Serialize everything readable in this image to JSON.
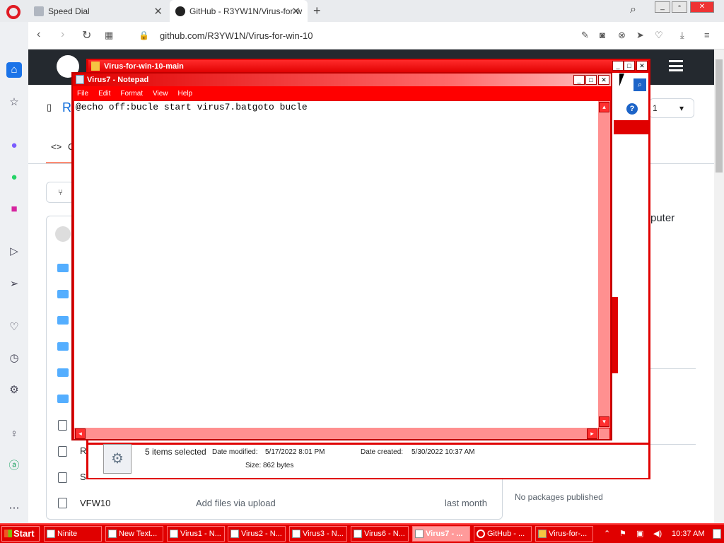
{
  "browser": {
    "tabs": [
      {
        "label": "Speed Dial",
        "icon": "speed-dial-icon"
      },
      {
        "label": "GitHub - R3YW1N/Virus-for-w",
        "icon": "github-icon"
      }
    ],
    "url": "github.com/R3YW1N/Virus-for-win-10"
  },
  "github": {
    "partial_heading": "R",
    "partial_code_tab": "C",
    "about_partial": "puter",
    "file_rows": [
      {
        "name": "R",
        "message": "",
        "time": ""
      },
      {
        "name": "S",
        "message": "",
        "time": ""
      },
      {
        "name": "VFW10",
        "message": "Add files via upload",
        "time": "last month"
      }
    ],
    "branch_count": "1",
    "packages_text": "No packages published"
  },
  "explorer": {
    "title": "Virus-for-win-10-main",
    "status": {
      "selected": "5 items selected",
      "modified_label": "Date modified:",
      "modified_value": "5/17/2022 8:01 PM",
      "created_label": "Date created:",
      "created_value": "5/30/2022 10:37 AM",
      "size_label": "Size:",
      "size_value": "862 bytes"
    }
  },
  "notepad": {
    "title": "Virus7 - Notepad",
    "menu": [
      "File",
      "Edit",
      "Format",
      "View",
      "Help"
    ],
    "content": "@echo off:bucle start virus7.batgoto bucle"
  },
  "taskbar": {
    "start_label": "Start",
    "items": [
      {
        "label": "Ninite",
        "active": false
      },
      {
        "label": "New Text...",
        "active": false
      },
      {
        "label": "Virus1 - N...",
        "active": false
      },
      {
        "label": "Virus2 - N...",
        "active": false
      },
      {
        "label": "Virus3 - N...",
        "active": false
      },
      {
        "label": "Virus6 - N...",
        "active": false
      },
      {
        "label": "Virus7 - ...",
        "active": true
      },
      {
        "label": "GitHub - ...",
        "active": false
      },
      {
        "label": "Virus-for-...",
        "active": false
      }
    ],
    "clock": "10:37 AM"
  },
  "colors": {
    "theme_red": "#e00000",
    "github_dark": "#24292f",
    "opera_red": "#e01b24"
  }
}
